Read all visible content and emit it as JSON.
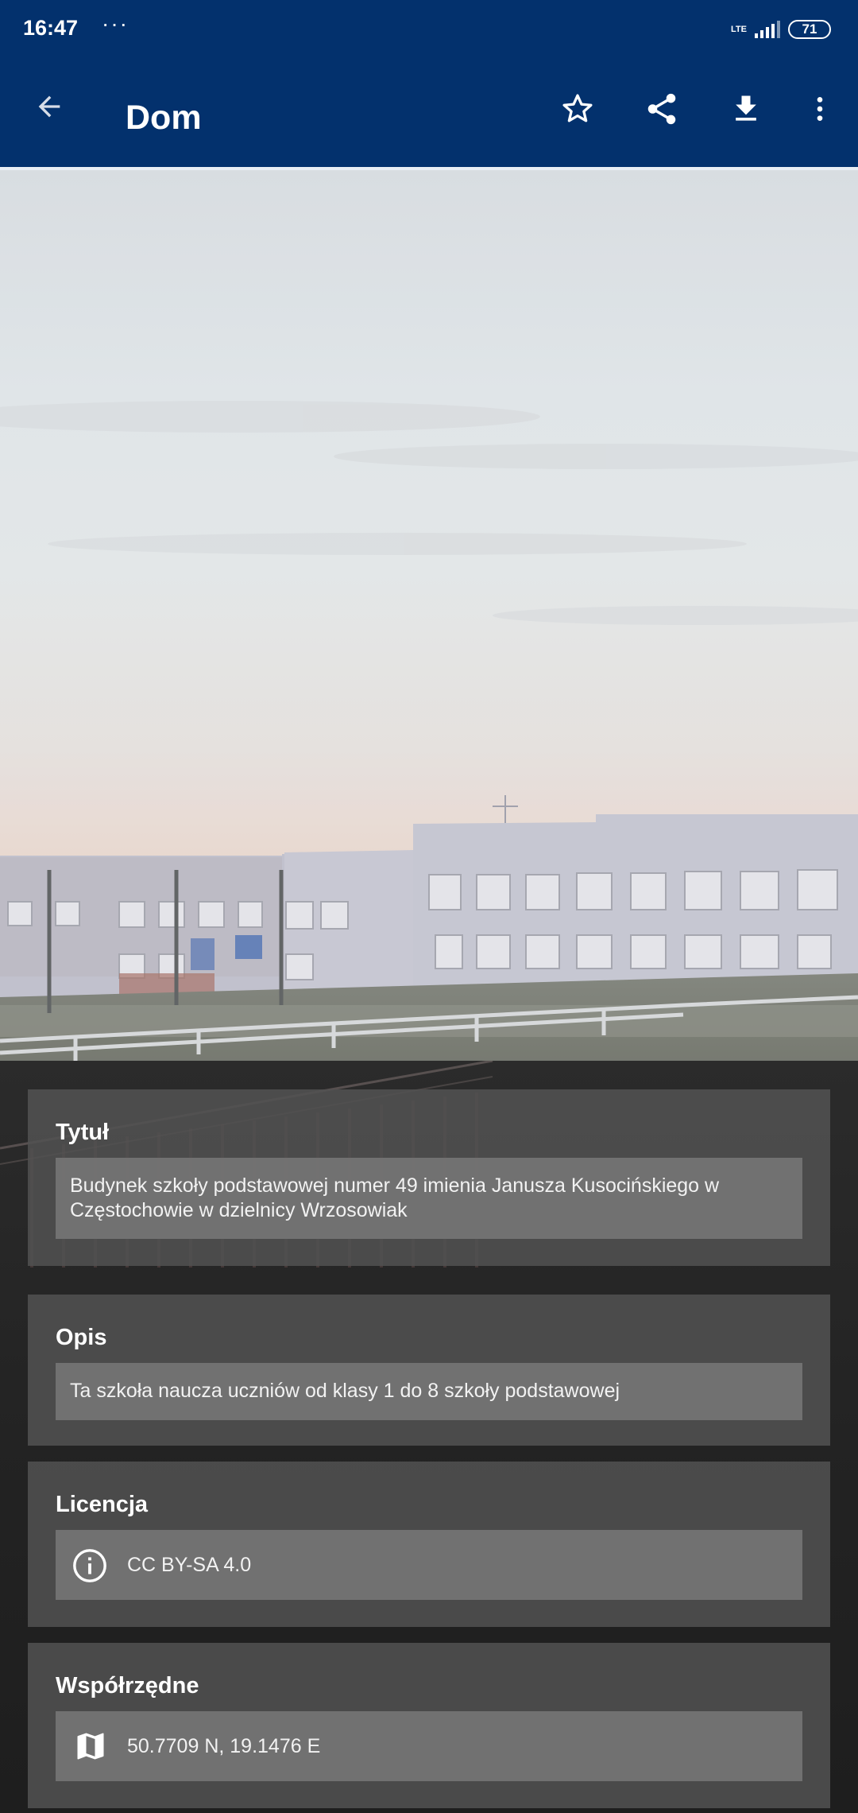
{
  "status_bar": {
    "time": "16:47",
    "overflow": "···",
    "network": "LTE",
    "battery": "71"
  },
  "app_bar": {
    "title": "Dom",
    "icons": [
      "arrow-back-icon",
      "star-outline-icon",
      "share-icon",
      "download-icon",
      "more-vert-icon"
    ]
  },
  "details": {
    "title_section": {
      "label": "Tytuł",
      "line1": "Budynek szkoły podstawowej numer 49 imienia Janusza Kusocińskiego w",
      "line2": "Częstochowie w dzielnicy Wrzosowiak"
    },
    "description_section": {
      "label": "Opis",
      "text": "Ta szkoła naucza uczniów od klasy 1 do 8 szkoły podstawowej"
    },
    "license_section": {
      "label": "Licencja",
      "text": "CC BY-SA 4.0",
      "icon": "info-icon"
    },
    "coordinates_section": {
      "label": "Współrzędne",
      "text": "50.7709 N, 19.1476 E",
      "icon": "map-icon"
    }
  },
  "colors": {
    "app_bar": "#03316d",
    "card": "#525252",
    "card_box": "#767676"
  }
}
